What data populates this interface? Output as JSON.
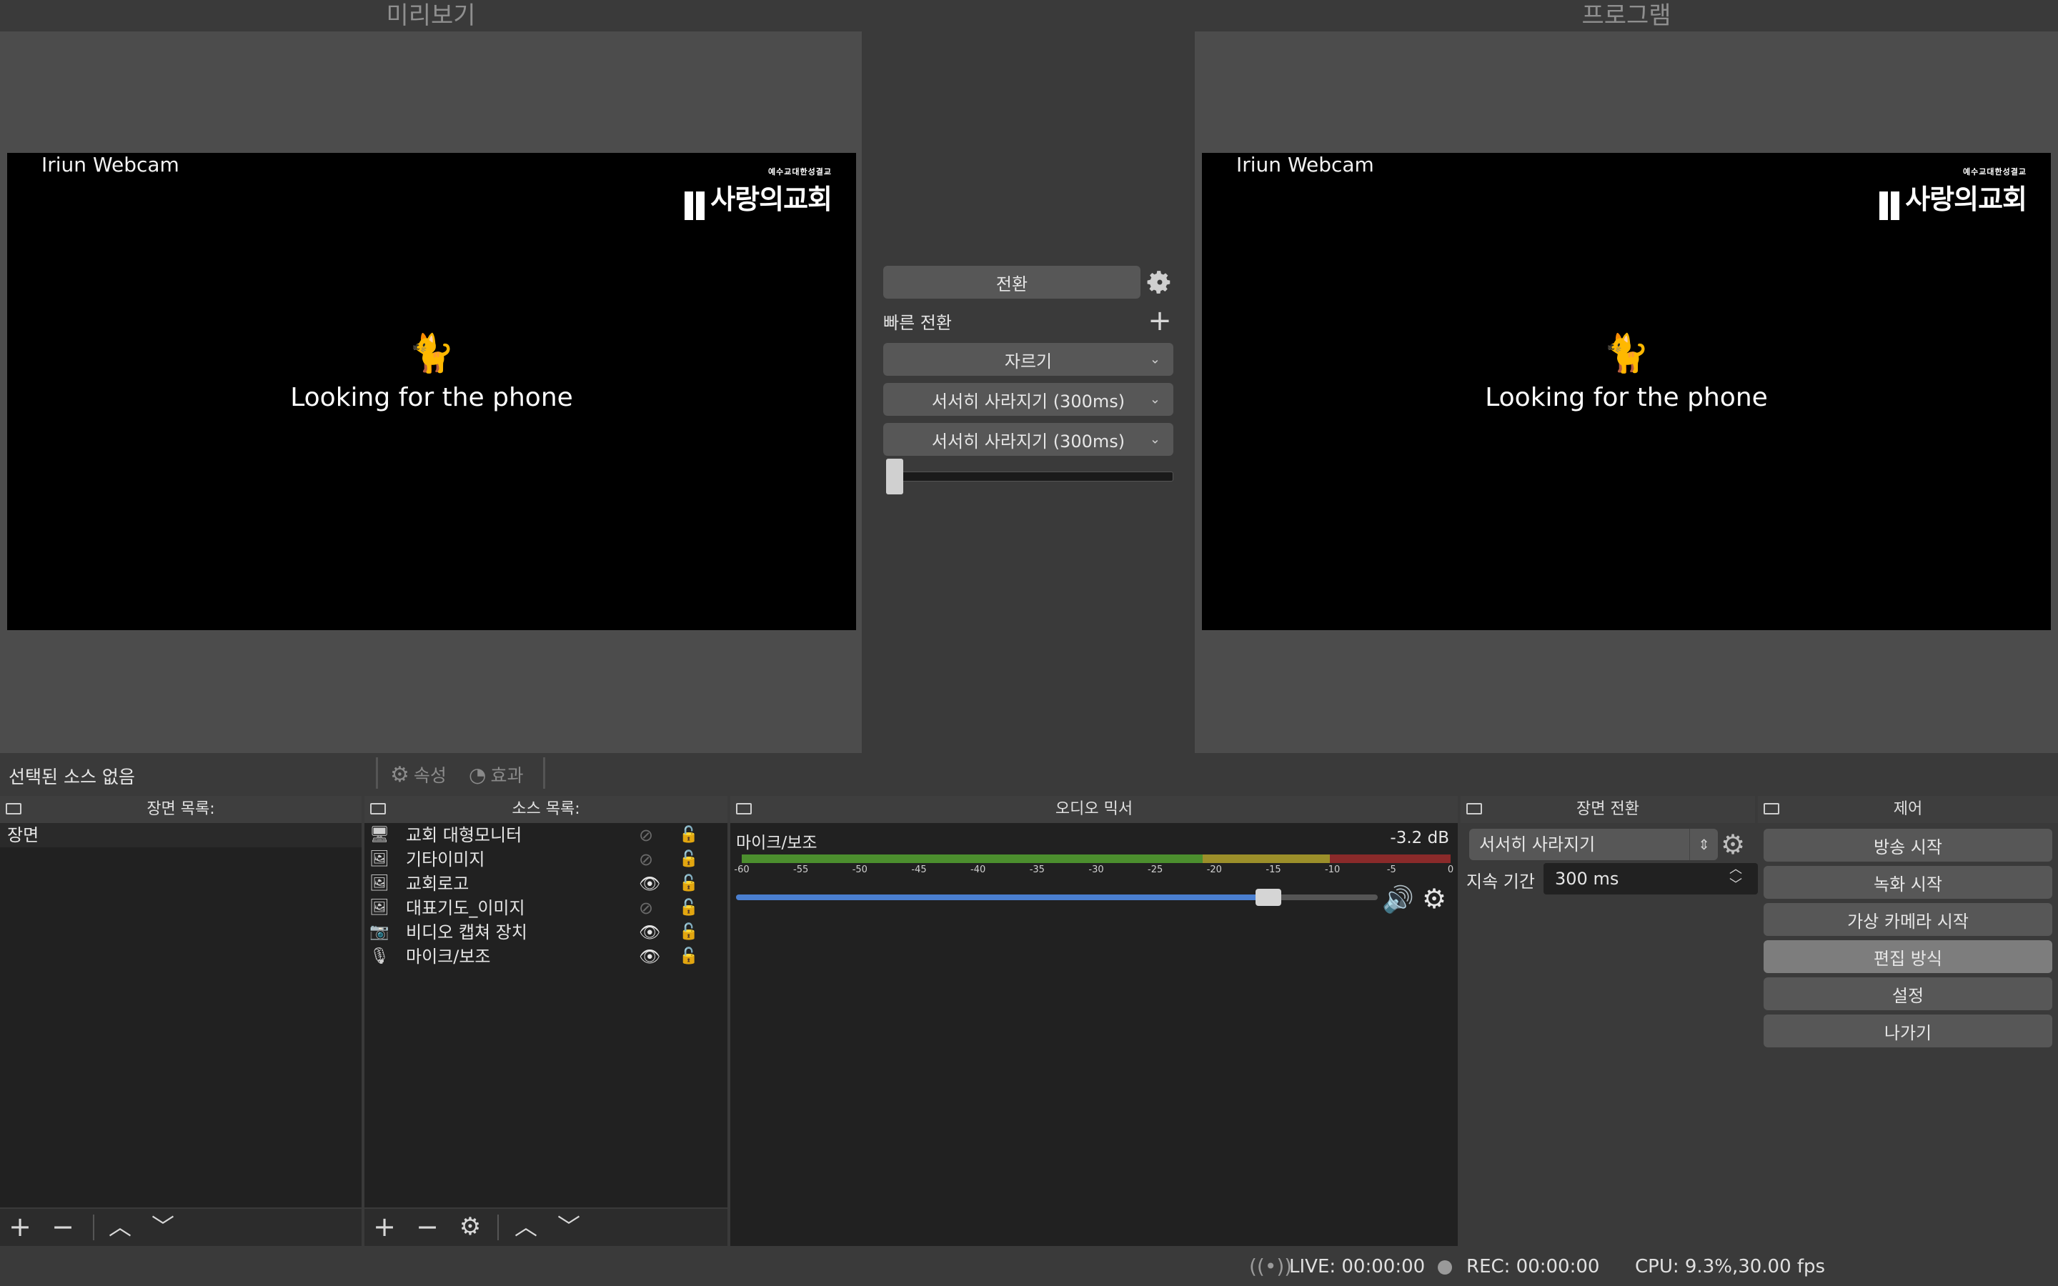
{
  "preview": {
    "title": "미리보기",
    "source_label": "Iriun Webcam",
    "message": "Looking for the phone",
    "logo_small": "예수교대한성결교",
    "logo_big": "사랑의교회"
  },
  "program": {
    "title": "프로그램",
    "source_label": "Iriun Webcam",
    "message": "Looking for the phone",
    "logo_small": "예수교대한성결교",
    "logo_big": "사랑의교회"
  },
  "transition_panel": {
    "transition_button": "전환",
    "quick_transitions_label": "빠른 전환",
    "quick_items": [
      "자르기",
      "서서히 사라지기 (300ms)",
      "서서히 사라지기 (300ms)"
    ],
    "t_bar_value": 0
  },
  "context_bar": {
    "no_source": "선택된 소스 없음",
    "properties": "속성",
    "filters": "효과"
  },
  "scenes": {
    "header": "장면 목록:",
    "items": [
      "장면"
    ]
  },
  "sources": {
    "header": "소스 목록:",
    "items": [
      {
        "name": "교회 대형모니터",
        "icon": "monitor-icon",
        "visible": false
      },
      {
        "name": "기타이미지",
        "icon": "image-icon",
        "visible": false
      },
      {
        "name": "교회로고",
        "icon": "image-icon",
        "visible": true
      },
      {
        "name": "대표기도_이미지",
        "icon": "image-icon",
        "visible": false
      },
      {
        "name": "비디오 캡쳐 장치",
        "icon": "camera-icon",
        "visible": true
      },
      {
        "name": "마이크/보조",
        "icon": "mic-icon",
        "visible": true
      }
    ]
  },
  "mixer": {
    "header": "오디오 믹서",
    "channel_name": "마이크/보조",
    "db_value": "-3.2 dB",
    "ticks": [
      "-60",
      "-55",
      "-50",
      "-45",
      "-40",
      "-35",
      "-30",
      "-25",
      "-20",
      "-15",
      "-10",
      "-5",
      "0"
    ],
    "volume_fraction": 0.83
  },
  "scene_transitions": {
    "header": "장면 전환",
    "selected": "서서히 사라지기",
    "duration_label": "지속 기간",
    "duration_value": "300 ms"
  },
  "controls": {
    "header": "제어",
    "buttons": [
      "방송 시작",
      "녹화 시작",
      "가상 카메라 시작",
      "편집 방식",
      "설정",
      "나가기"
    ]
  },
  "status_bar": {
    "live": "LIVE: 00:00:00",
    "rec": "REC: 00:00:00",
    "cpu": "CPU: 9.3%,30.00 fps"
  }
}
